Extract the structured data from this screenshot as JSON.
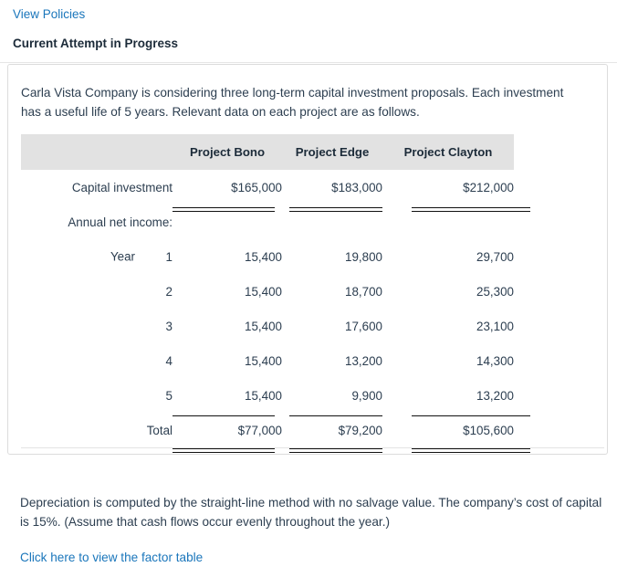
{
  "top": {
    "view_policies_label": "View Policies",
    "attempt_heading": "Current Attempt in Progress"
  },
  "problem": {
    "intro": "Carla Vista Company is considering three long-term capital investment proposals. Each investment has a useful life of 5 years. Relevant data on each project are as follows.",
    "closing": "Depreciation is computed by the straight-line method with no salvage value. The company’s cost of capital is 15%. (Assume that cash flows occur evenly throughout the year.)",
    "factor_table_link": "Click here to view the factor table"
  },
  "table": {
    "columns": [
      "",
      "Project Bono",
      "Project Edge",
      "Project Clayton"
    ],
    "rows": [
      {
        "label": "Capital investment",
        "type": "capital",
        "values": [
          "$165,000",
          "$183,000",
          "$212,000"
        ]
      },
      {
        "label": "Annual net income:",
        "type": "section",
        "values": [
          "",
          "",
          ""
        ]
      },
      {
        "label": "Year  1",
        "year_word": "Year",
        "year_num": "1",
        "type": "year",
        "values": [
          "15,400",
          "19,800",
          "29,700"
        ]
      },
      {
        "label": "2",
        "year_word": "",
        "year_num": "2",
        "type": "year",
        "values": [
          "15,400",
          "18,700",
          "25,300"
        ]
      },
      {
        "label": "3",
        "year_word": "",
        "year_num": "3",
        "type": "year",
        "values": [
          "15,400",
          "17,600",
          "23,100"
        ]
      },
      {
        "label": "4",
        "year_word": "",
        "year_num": "4",
        "type": "year",
        "values": [
          "15,400",
          "13,200",
          "14,300"
        ]
      },
      {
        "label": "5",
        "year_word": "",
        "year_num": "5",
        "type": "year",
        "values": [
          "15,400",
          "9,900",
          "13,200"
        ]
      },
      {
        "label": "Total",
        "type": "total",
        "values": [
          "$77,000",
          "$79,200",
          "$105,600"
        ]
      }
    ]
  },
  "colors": {
    "link": "#1a76bb",
    "text": "#2c3e50",
    "heading": "#1c2b39",
    "header_band": "#e2e2e2",
    "border": "#dcdcdc"
  }
}
